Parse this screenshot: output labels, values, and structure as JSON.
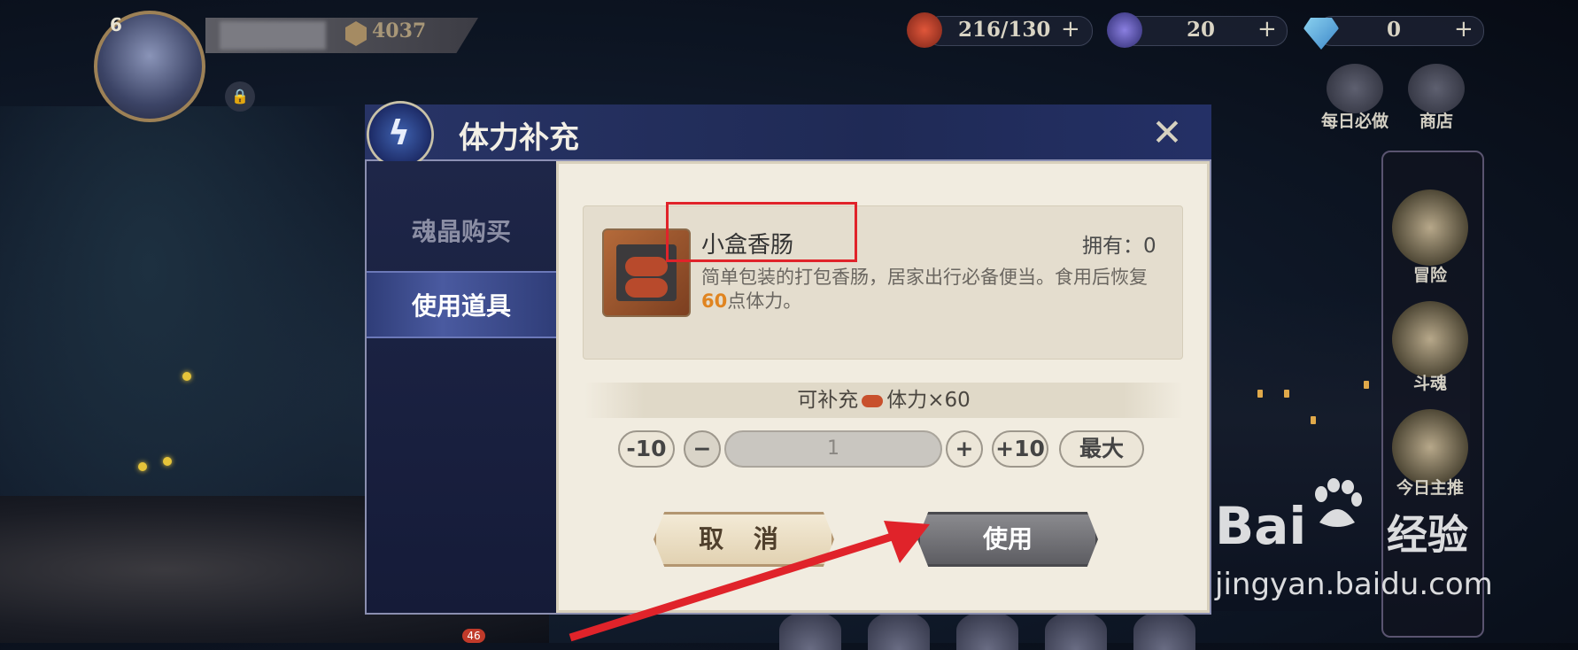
{
  "player": {
    "level": "6",
    "power": "4037"
  },
  "resources": [
    {
      "icon": "sausage-stamina-icon",
      "value": "216/130"
    },
    {
      "icon": "soul-crystal-icon",
      "value": "20"
    },
    {
      "icon": "diamond-icon",
      "value": "0"
    }
  ],
  "top_menu": {
    "daily": "每日必做",
    "shop": "商店"
  },
  "side_menu": {
    "adventure": "冒险",
    "soul_fight": "斗魂",
    "main_push": "今日主推"
  },
  "dialog": {
    "title": "体力补充",
    "tabs": [
      {
        "label": "魂晶购买",
        "active": false
      },
      {
        "label": "使用道具",
        "active": true
      }
    ],
    "item": {
      "name": "小盒香肠",
      "own_label": "拥有：0",
      "desc_part1": "简单包装的打包香肠，居家出行必备便当。食用后恢复",
      "desc_highlight": "60",
      "desc_part2": "点体力。"
    },
    "refill_prefix": "可补充",
    "refill_suffix": "体力×60",
    "controls": {
      "minus10": "-10",
      "minus": "−",
      "quantity": "1",
      "plus": "+",
      "plus10": "+10",
      "max": "最大"
    },
    "cancel": "取 消",
    "use": "使用"
  },
  "watermark": {
    "brand": "Bai",
    "brand2": "经验",
    "url": "jingyan.baidu.com"
  },
  "notification_count": "46",
  "colors": {
    "highlight_orange": "#e08420",
    "annotation_red": "#e0232a",
    "dialog_header": "#283466"
  }
}
